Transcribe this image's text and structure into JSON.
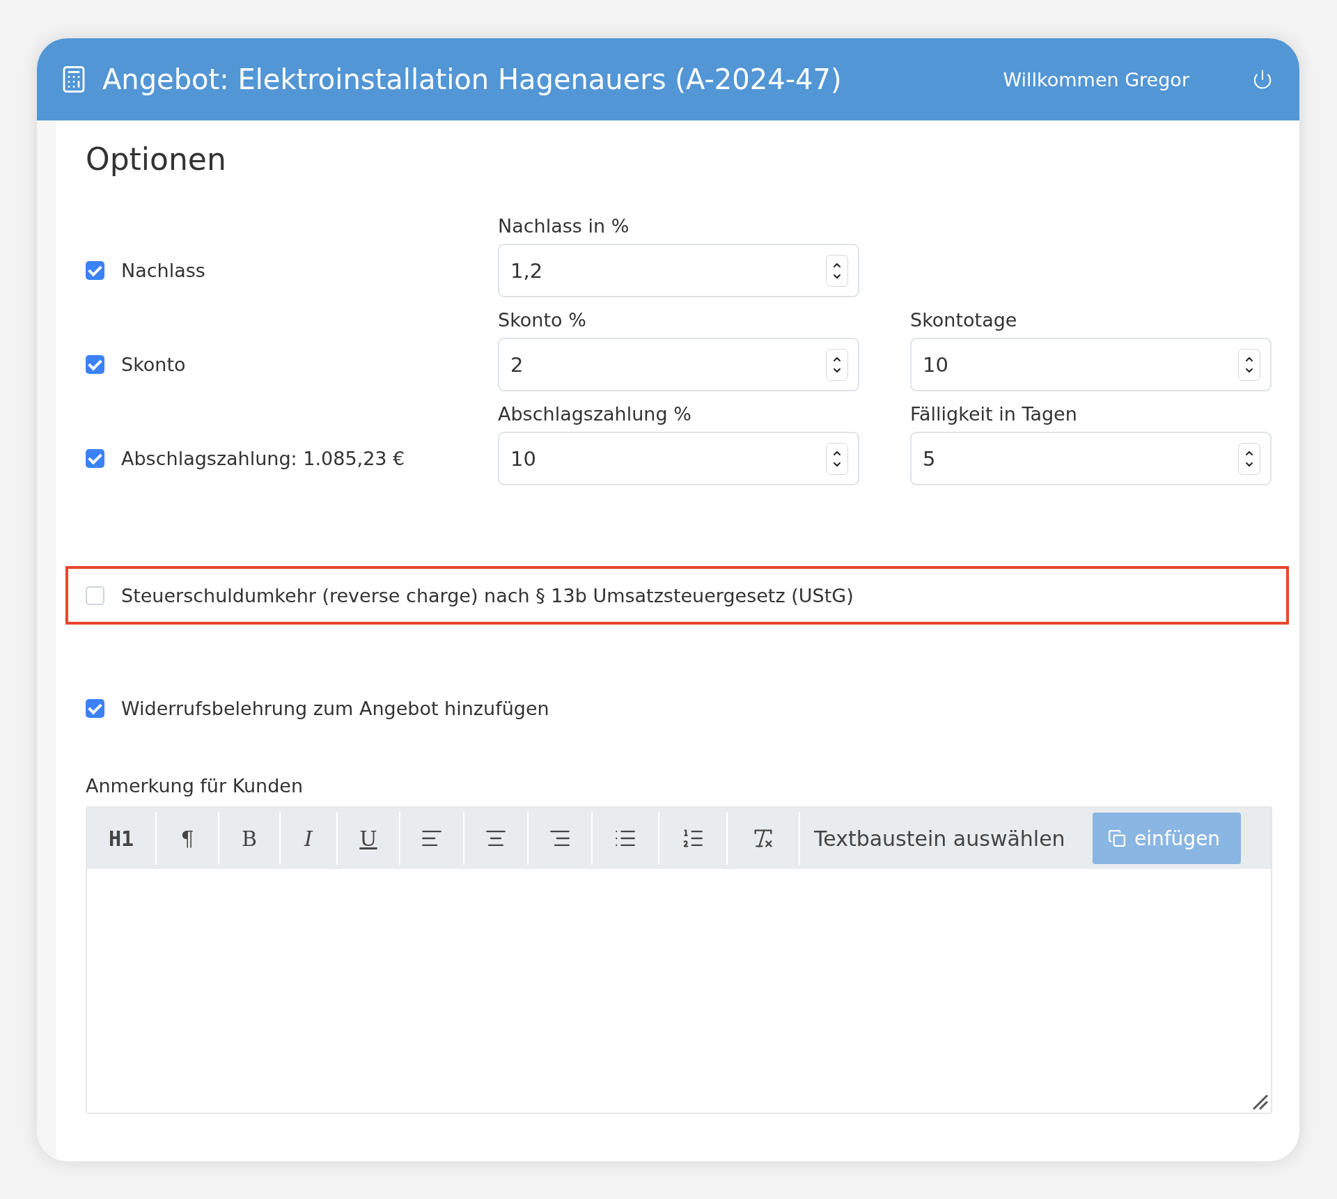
{
  "header": {
    "title": "Angebot: Elektroinstallation Hagenauers (A-2024-47)",
    "welcome": "Willkommen Gregor"
  },
  "section_title": "Optionen",
  "options": [
    {
      "label": "Nachlass",
      "checked": true,
      "fields": [
        {
          "label": "Nachlass in %",
          "value": "1,2"
        }
      ]
    },
    {
      "label": "Skonto",
      "checked": true,
      "fields": [
        {
          "label": "Skonto %",
          "value": "2"
        },
        {
          "label": "Skontotage",
          "value": "10"
        }
      ]
    },
    {
      "label": "Abschlagszahlung: 1.085,23 €",
      "checked": true,
      "fields": [
        {
          "label": "Abschlagszahlung %",
          "value": "10"
        },
        {
          "label": "Fälligkeit in Tagen",
          "value": "5"
        }
      ]
    }
  ],
  "reverse_charge": {
    "label": "Steuerschuldumkehr (reverse charge) nach § 13b Umsatzsteuergesetz (UStG)",
    "checked": false,
    "highlighted": true
  },
  "withdrawal": {
    "label": "Widerrufsbelehrung zum Angebot hinzufügen",
    "checked": true
  },
  "editor": {
    "label": "Anmerkung für Kunden",
    "tools": [
      {
        "kind": "heading",
        "label": "H1"
      },
      {
        "kind": "paragraph",
        "label": "¶"
      },
      {
        "kind": "bold",
        "label": "B"
      },
      {
        "kind": "italic",
        "label": "I"
      },
      {
        "kind": "underline",
        "label": "U"
      },
      {
        "kind": "left"
      },
      {
        "kind": "center"
      },
      {
        "kind": "right"
      },
      {
        "kind": "bullets"
      },
      {
        "kind": "numbers"
      },
      {
        "kind": "clear"
      }
    ],
    "snippet_select": "Textbaustein auswählen",
    "insert_button": "einfügen"
  }
}
